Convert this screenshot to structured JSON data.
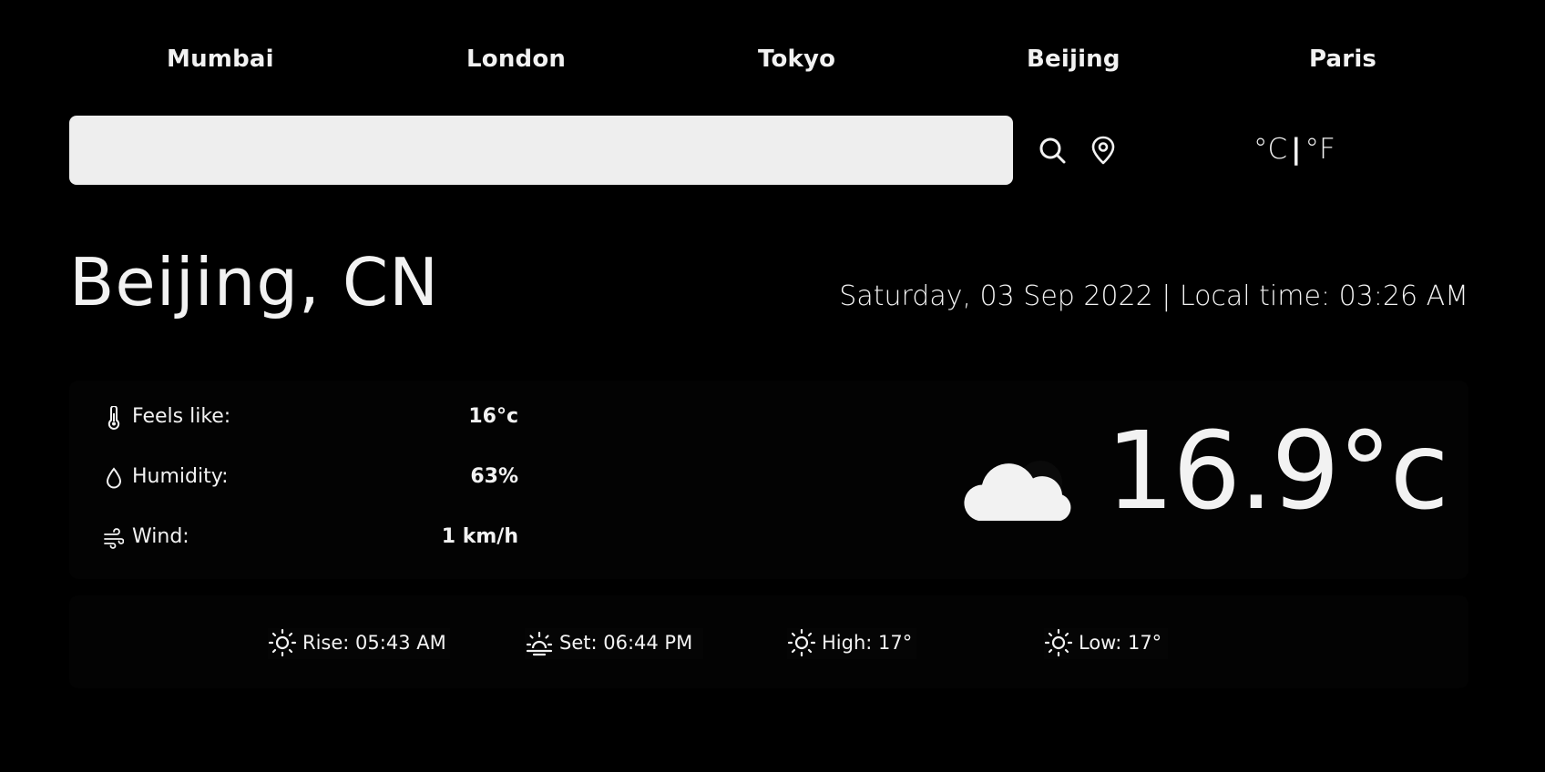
{
  "cities": [
    "Mumbai",
    "London",
    "Tokyo",
    "Beijing",
    "Paris"
  ],
  "search": {
    "value": "",
    "placeholder": ""
  },
  "units": {
    "celsius": "°C",
    "separator": "|",
    "fahrenheit": "°F"
  },
  "location": {
    "name": "Beijing, CN",
    "datetime": "Saturday, 03 Sep 2022 | Local time: 03:26 AM"
  },
  "current": {
    "icon": "cloud-icon",
    "temperature": "16.9°c"
  },
  "details": [
    {
      "icon": "thermometer-icon",
      "label": "Feels like:",
      "value": "16°c"
    },
    {
      "icon": "droplet-icon",
      "label": "Humidity:",
      "value": "63%"
    },
    {
      "icon": "wind-icon",
      "label": "Wind:",
      "value": "1 km/h"
    }
  ],
  "sun_items": [
    {
      "icon": "sun-icon",
      "text": "Rise: 05:43 AM"
    },
    {
      "icon": "sunset-icon",
      "text": "Set: 06:44 PM"
    },
    {
      "icon": "sun-icon",
      "text": "High: 17°"
    },
    {
      "icon": "sun-icon",
      "text": "Low: 17°"
    }
  ],
  "colors": {
    "background": "#000000",
    "text": "#f2f2f2",
    "search_bar": "#eeeeee"
  }
}
